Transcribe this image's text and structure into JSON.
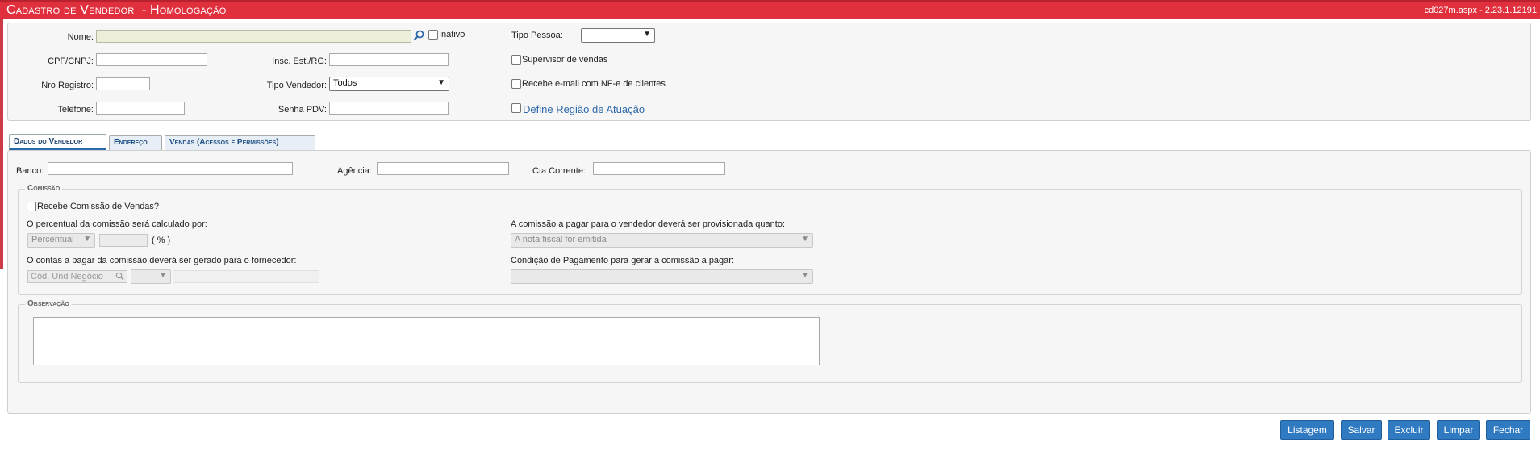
{
  "header": {
    "title": "Cadastro de Vendedor  - Homologação",
    "version": "cd027m.aspx - 2.23.1.12191"
  },
  "top_form": {
    "nome_label": "Nome:",
    "nome_value": "",
    "inativo_label": "Inativo",
    "tipo_pessoa_label": "Tipo Pessoa:",
    "tipo_pessoa_value": "",
    "cpf_label": "CPF/CNPJ:",
    "insc_label": "Insc. Est./RG:",
    "supervisor_label": "Supervisor de vendas",
    "nro_registro_label": "Nro Registro:",
    "tipo_vendedor_label": "Tipo Vendedor:",
    "tipo_vendedor_value": "Todos",
    "recebe_email_label": "Recebe e-mail com NF-e de clientes",
    "telefone_label": "Telefone:",
    "senha_pdv_label": "Senha PDV:",
    "define_regiao_label": "Define Região de Atuação"
  },
  "tabs": [
    {
      "label": "Dados do Vendedor",
      "active": true
    },
    {
      "label": "Endereço",
      "active": false
    },
    {
      "label": "Vendas (Acessos e Permissões)",
      "active": false
    }
  ],
  "dados": {
    "banco_label": "Banco:",
    "agencia_label": "Agência:",
    "cta_corrente_label": "Cta Corrente:"
  },
  "comissao": {
    "legend": "Comissão",
    "recebe_label": "Recebe Comissão de Vendas?",
    "percentual_label": "O percentual da comissão será calculado por:",
    "percentual_select": "Percentual",
    "percent_unit": "( % )",
    "provisionada_label": "A comissão a pagar para o vendedor deverá ser provisionada quanto:",
    "provisionada_select": "A nota fiscal for emitida",
    "contas_label": "O contas a pagar da comissão deverá ser gerado para o fornecedor:",
    "und_negocio_placeholder": "Cód. Und Negócio",
    "condicao_label": "Condição de Pagamento para gerar a comissão a pagar:"
  },
  "observacao": {
    "legend": "Observação"
  },
  "buttons": {
    "listagem": "Listagem",
    "salvar": "Salvar",
    "excluir": "Excluir",
    "limpar": "Limpar",
    "fechar": "Fechar"
  },
  "colors": {
    "title_bar": "#e0303d",
    "button": "#2f7ac1",
    "link": "#2c68a8"
  }
}
